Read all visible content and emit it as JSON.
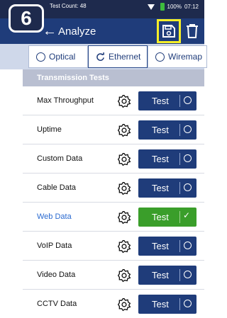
{
  "status_bar": {
    "test_count": "Test Count: 48",
    "battery": "100%",
    "time": "07:12"
  },
  "callout": {
    "number": "6"
  },
  "header": {
    "title": "Analyze",
    "back_glyph": "←"
  },
  "tabs": [
    {
      "label": "Optical",
      "icon": "radio-empty-icon",
      "active": false
    },
    {
      "label": "Ethernet",
      "icon": "refresh-icon",
      "active": true
    },
    {
      "label": "Wiremap",
      "icon": "radio-empty-icon",
      "active": false
    }
  ],
  "section": {
    "title": "Transmission Tests"
  },
  "tests": [
    {
      "label": "Max Throughput",
      "button": "Test",
      "status": "idle"
    },
    {
      "label": "Uptime",
      "button": "Test",
      "status": "idle"
    },
    {
      "label": "Custom Data",
      "button": "Test",
      "status": "idle"
    },
    {
      "label": "Cable Data",
      "button": "Test",
      "status": "idle"
    },
    {
      "label": "Web Data",
      "button": "Test",
      "status": "passed"
    },
    {
      "label": "VoIP Data",
      "button": "Test",
      "status": "idle"
    },
    {
      "label": "Video Data",
      "button": "Test",
      "status": "idle"
    },
    {
      "label": "CCTV Data",
      "button": "Test",
      "status": "idle"
    }
  ],
  "colors": {
    "header": "#1f3c7a",
    "highlight": "#f5ee28",
    "pass": "#3a9e2a"
  }
}
